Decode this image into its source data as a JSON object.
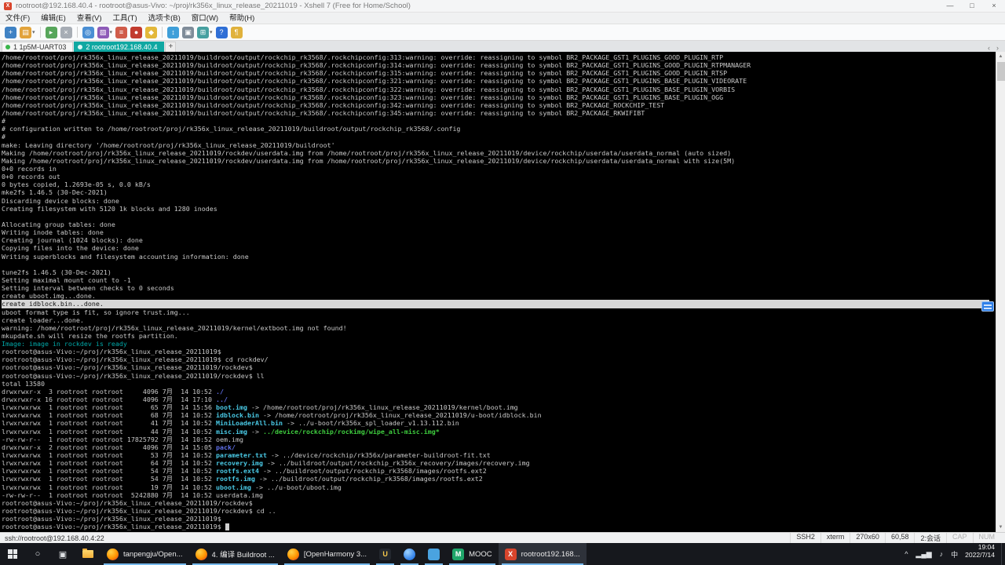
{
  "theme": {
    "tab_active_bg": "#0fa8a2",
    "terminal_bg": "#000000",
    "text_normal": "#c9c9c9",
    "text_teal": "#00a8a8",
    "text_symlink": "#49c8e4",
    "text_dir": "#5f6fe8",
    "text_exec": "#3ecb3e",
    "selection_bg": "#d6d6d6",
    "selection_fg": "#111111",
    "taskbar_bg": "#16181d"
  },
  "window": {
    "title": "rootroot@192.168.40.4 - rootroot@asus-Vivo: ~/proj/rk356x_linux_release_20211019 - Xshell 7 (Free for Home/School)",
    "icon_glyph": "X",
    "controls": [
      {
        "name": "minimize-button",
        "glyph": "—"
      },
      {
        "name": "maximize-button",
        "glyph": "□"
      },
      {
        "name": "close-button",
        "glyph": "×"
      }
    ]
  },
  "menu": {
    "items": [
      "文件(F)",
      "编辑(E)",
      "查看(V)",
      "工具(T)",
      "选项卡(B)",
      "窗口(W)",
      "帮助(H)"
    ]
  },
  "toolbar": {
    "icons": [
      {
        "name": "new-session-icon",
        "glyph": "+",
        "color": "#3f82c4"
      },
      {
        "name": "open-sessions-icon",
        "glyph": "▤",
        "color": "#e2a33b",
        "dropdown": true
      },
      {
        "sep": true
      },
      {
        "name": "connect-icon",
        "glyph": "▸",
        "color": "#57a65b"
      },
      {
        "name": "disconnect-icon",
        "glyph": "×",
        "color": "#a7adb5"
      },
      {
        "sep": true
      },
      {
        "name": "find-icon",
        "glyph": "◎",
        "color": "#4a8fd4"
      },
      {
        "name": "color-scheme-icon",
        "glyph": "▧",
        "color": "#8e5bb8",
        "dropdown": true
      },
      {
        "name": "quick-command-icon",
        "glyph": "≡",
        "color": "#d05c4a"
      },
      {
        "name": "record-icon",
        "glyph": "●",
        "color": "#c23b2e"
      },
      {
        "name": "lock-screen-icon",
        "glyph": "◆",
        "color": "#e3b83a"
      },
      {
        "sep": true
      },
      {
        "name": "file-transfer-icon",
        "glyph": "↕",
        "color": "#3f9fd9"
      },
      {
        "name": "print-icon",
        "glyph": "▣",
        "color": "#7f8c99"
      },
      {
        "name": "layout-icon",
        "glyph": "⊞",
        "color": "#46a0a0",
        "dropdown": true
      },
      {
        "name": "help-icon",
        "glyph": "?",
        "color": "#2f6fd6"
      },
      {
        "name": "chat-icon",
        "glyph": "¶",
        "color": "#e0b23c"
      }
    ]
  },
  "tabs": [
    {
      "label": "1 1p5M-UART03",
      "active": false
    },
    {
      "label": "2 rootroot192.168.40.4",
      "active": true
    }
  ],
  "tabbar": {
    "add_label": "+",
    "scroll_left": "‹",
    "scroll_right": "›"
  },
  "terminal": {
    "lines": [
      "/home/rootroot/proj/rk356x_linux_release_20211019/buildroot/output/rockchip_rk3568/.rockchipconfig:313:warning: override: reassigning to symbol BR2_PACKAGE_GST1_PLUGINS_GOOD_PLUGIN_RTP",
      "/home/rootroot/proj/rk356x_linux_release_20211019/buildroot/output/rockchip_rk3568/.rockchipconfig:314:warning: override: reassigning to symbol BR2_PACKAGE_GST1_PLUGINS_GOOD_PLUGIN_RTPMANAGER",
      "/home/rootroot/proj/rk356x_linux_release_20211019/buildroot/output/rockchip_rk3568/.rockchipconfig:315:warning: override: reassigning to symbol BR2_PACKAGE_GST1_PLUGINS_GOOD_PLUGIN_RTSP",
      "/home/rootroot/proj/rk356x_linux_release_20211019/buildroot/output/rockchip_rk3568/.rockchipconfig:321:warning: override: reassigning to symbol BR2_PACKAGE_GST1_PLUGINS_BASE_PLUGIN_VIDEORATE",
      "/home/rootroot/proj/rk356x_linux_release_20211019/buildroot/output/rockchip_rk3568/.rockchipconfig:322:warning: override: reassigning to symbol BR2_PACKAGE_GST1_PLUGINS_BASE_PLUGIN_VORBIS",
      "/home/rootroot/proj/rk356x_linux_release_20211019/buildroot/output/rockchip_rk3568/.rockchipconfig:323:warning: override: reassigning to symbol BR2_PACKAGE_GST1_PLUGINS_BASE_PLUGIN_OGG",
      "/home/rootroot/proj/rk356x_linux_release_20211019/buildroot/output/rockchip_rk3568/.rockchipconfig:342:warning: override: reassigning to symbol BR2_PACKAGE_ROCKCHIP_TEST",
      "/home/rootroot/proj/rk356x_linux_release_20211019/buildroot/output/rockchip_rk3568/.rockchipconfig:345:warning: override: reassigning to symbol BR2_PACKAGE_RKWIFIBT",
      "#",
      "# configuration written to /home/rootroot/proj/rk356x_linux_release_20211019/buildroot/output/rockchip_rk3568/.config",
      "#",
      "make: Leaving directory '/home/rootroot/proj/rk356x_linux_release_20211019/buildroot'",
      "Making /home/rootroot/proj/rk356x_linux_release_20211019/rockdev/userdata.img from /home/rootroot/proj/rk356x_linux_release_20211019/device/rockchip/userdata/userdata_normal (auto sized)",
      "Making /home/rootroot/proj/rk356x_linux_release_20211019/rockdev/userdata.img from /home/rootroot/proj/rk356x_linux_release_20211019/device/rockchip/userdata/userdata_normal with size(5M)",
      "0+0 records in",
      "0+0 records out",
      "0 bytes copied, 1.2693e-05 s, 0.0 kB/s",
      "mke2fs 1.46.5 (30-Dec-2021)",
      "Discarding device blocks: done",
      "Creating filesystem with 5120 1k blocks and 1280 inodes",
      "",
      "Allocating group tables: done",
      "Writing inode tables: done",
      "Creating journal (1024 blocks): done",
      "Copying files into the device: done",
      "Writing superblocks and filesystem accounting information: done",
      "",
      "tune2fs 1.46.5 (30-Dec-2021)",
      "Setting maximal mount count to -1",
      "Setting interval between checks to 0 seconds",
      "create uboot.img...done.",
      {
        "bg": "sel",
        "segs": [
          [
            "create idblock.bin...done.",
            "p"
          ]
        ]
      },
      "uboot format type is fit, so ignore trust.img...",
      "create loader...done.",
      "warning: /home/rootroot/proj/rk356x_linux_release_20211019/kernel/extboot.img not found!",
      "mkupdate.sh will resize the rootfs partition.",
      {
        "segs": [
          [
            "Image: image in rockdev is ready",
            "cy"
          ]
        ]
      },
      "rootroot@asus-Vivo:~/proj/rk356x_linux_release_20211019$",
      "rootroot@asus-Vivo:~/proj/rk356x_linux_release_20211019$ cd rockdev/",
      "rootroot@asus-Vivo:~/proj/rk356x_linux_release_20211019/rockdev$",
      "rootroot@asus-Vivo:~/proj/rk356x_linux_release_20211019/rockdev$ ll",
      "total 13580",
      {
        "segs": [
          [
            "drwxrwxr-x  3 rootroot rootroot     4096 7月  14 10:52 ",
            "p"
          ],
          [
            "./",
            "dir"
          ]
        ]
      },
      {
        "segs": [
          [
            "drwxrwxr-x 16 rootroot rootroot     4096 7月  14 17:10 ",
            "p"
          ],
          [
            "../",
            "dir"
          ]
        ]
      },
      {
        "segs": [
          [
            "lrwxrwxrwx  1 rootroot rootroot       65 7月  14 15:56 ",
            "p"
          ],
          [
            "boot.img",
            "ln"
          ],
          [
            " -> /home/rootroot/proj/rk356x_linux_release_20211019/kernel/boot.img",
            "p"
          ]
        ]
      },
      {
        "segs": [
          [
            "lrwxrwxrwx  1 rootroot rootroot       68 7月  14 10:52 ",
            "p"
          ],
          [
            "idblock.bin",
            "ln"
          ],
          [
            " -> /home/rootroot/proj/rk356x_linux_release_20211019/u-boot/idblock.bin",
            "p"
          ]
        ]
      },
      {
        "segs": [
          [
            "lrwxrwxrwx  1 rootroot rootroot       41 7月  14 10:52 ",
            "p"
          ],
          [
            "MiniLoaderAll.bin",
            "ln"
          ],
          [
            " -> ../u-boot/rk356x_spl_loader_v1.13.112.bin",
            "p"
          ]
        ]
      },
      {
        "segs": [
          [
            "lrwxrwxrwx  1 rootroot rootroot       44 7月  14 10:52 ",
            "p"
          ],
          [
            "misc.img",
            "ln"
          ],
          [
            " -> ",
            "p"
          ],
          [
            "../device/rockchip/rockimg/wipe_all-misc.img*",
            "ex"
          ]
        ]
      },
      "-rw-rw-r--  1 rootroot rootroot 17825792 7月  14 10:52 oem.img",
      {
        "segs": [
          [
            "drwxrwxr-x  2 rootroot rootroot     4096 7月  14 15:05 ",
            "p"
          ],
          [
            "pack/",
            "dir"
          ]
        ]
      },
      {
        "segs": [
          [
            "lrwxrwxrwx  1 rootroot rootroot       53 7月  14 10:52 ",
            "p"
          ],
          [
            "parameter.txt",
            "ln"
          ],
          [
            " -> ../device/rockchip/rk356x/parameter-buildroot-fit.txt",
            "p"
          ]
        ]
      },
      {
        "segs": [
          [
            "lrwxrwxrwx  1 rootroot rootroot       64 7月  14 10:52 ",
            "p"
          ],
          [
            "recovery.img",
            "ln"
          ],
          [
            " -> ../buildroot/output/rockchip_rk356x_recovery/images/recovery.img",
            "p"
          ]
        ]
      },
      {
        "segs": [
          [
            "lrwxrwxrwx  1 rootroot rootroot       54 7月  14 10:52 ",
            "p"
          ],
          [
            "rootfs.ext4",
            "ln"
          ],
          [
            " -> ../buildroot/output/rockchip_rk3568/images/rootfs.ext2",
            "p"
          ]
        ]
      },
      {
        "segs": [
          [
            "lrwxrwxrwx  1 rootroot rootroot       54 7月  14 10:52 ",
            "p"
          ],
          [
            "rootfs.img",
            "ln"
          ],
          [
            " -> ../buildroot/output/rockchip_rk3568/images/rootfs.ext2",
            "p"
          ]
        ]
      },
      {
        "segs": [
          [
            "lrwxrwxrwx  1 rootroot rootroot       19 7月  14 10:52 ",
            "p"
          ],
          [
            "uboot.img",
            "ln"
          ],
          [
            " -> ../u-boot/uboot.img",
            "p"
          ]
        ]
      },
      "-rw-rw-r--  1 rootroot rootroot  5242880 7月  14 10:52 userdata.img",
      "rootroot@asus-Vivo:~/proj/rk356x_linux_release_20211019/rockdev$",
      "rootroot@asus-Vivo:~/proj/rk356x_linux_release_20211019/rockdev$ cd ..",
      "rootroot@asus-Vivo:~/proj/rk356x_linux_release_20211019$",
      {
        "segs": [
          [
            "rootroot@asus-Vivo:~/proj/rk356x_linux_release_20211019$ ",
            "p"
          ],
          [
            " ",
            "cur"
          ]
        ]
      }
    ]
  },
  "statusbar": {
    "left": "ssh://rootroot@192.168.40.4:22",
    "items": [
      {
        "label": "SSH2"
      },
      {
        "label": "xterm"
      },
      {
        "label": "270x60"
      },
      {
        "label": "60,58"
      },
      {
        "label": "2:会话"
      },
      {
        "label": "CAP",
        "dim": true
      },
      {
        "label": "NUM",
        "dim": true
      }
    ]
  },
  "taskbar": {
    "system": [
      {
        "name": "start-button",
        "kind": "start"
      },
      {
        "name": "search-icon",
        "kind": "glyph",
        "glyph": "○"
      },
      {
        "name": "task-view-icon",
        "kind": "glyph",
        "glyph": "▣"
      },
      {
        "name": "file-explorer-icon",
        "kind": "folder"
      }
    ],
    "apps": [
      {
        "name": "taskbar-app-tanpengju",
        "icon": "firefox-icon",
        "icon_class": "ic-firefox",
        "glyph": "",
        "label": "tanpengju/Open...",
        "open": true
      },
      {
        "name": "taskbar-app-buildroot-doc",
        "icon": "firefox-icon",
        "icon_class": "ic-firefox",
        "glyph": "",
        "label": "4. 编译 Buildroot ...",
        "open": true
      },
      {
        "name": "taskbar-app-openharmony",
        "icon": "firefox-icon",
        "icon_class": "ic-firefox",
        "glyph": "",
        "label": "[OpenHarmony 3...",
        "open": true
      },
      {
        "name": "taskbar-app-ultraedit",
        "icon": "ultraedit-icon",
        "icon_class": "ic-ultraedit",
        "glyph": "U",
        "open": true
      },
      {
        "name": "taskbar-app-browser",
        "icon": "browser-icon",
        "icon_class": "ic-browser",
        "glyph": "",
        "open": true
      },
      {
        "name": "taskbar-app-notes",
        "icon": "notes-icon",
        "icon_class": "ic-notes",
        "glyph": "",
        "open": true
      },
      {
        "name": "taskbar-app-mooc",
        "icon": "mooc-icon",
        "icon_class": "ic-mooc",
        "glyph": "M",
        "label": "MOOC",
        "open": true
      },
      {
        "name": "taskbar-app-xshell",
        "icon": "xshell-icon",
        "icon_class": "ic-xshell",
        "glyph": "X",
        "label": "rootroot192.168...",
        "open": true,
        "active": true
      }
    ],
    "tray": [
      {
        "name": "hidden-icons-chevron-icon",
        "glyph": "^"
      },
      {
        "name": "network-icon",
        "glyph": "▂▄▆"
      },
      {
        "name": "volume-icon",
        "glyph": "♪"
      },
      {
        "name": "input-method-indicator",
        "glyph": "中"
      }
    ],
    "clock": {
      "time": "19:04",
      "date": "2022/7/14"
    }
  }
}
